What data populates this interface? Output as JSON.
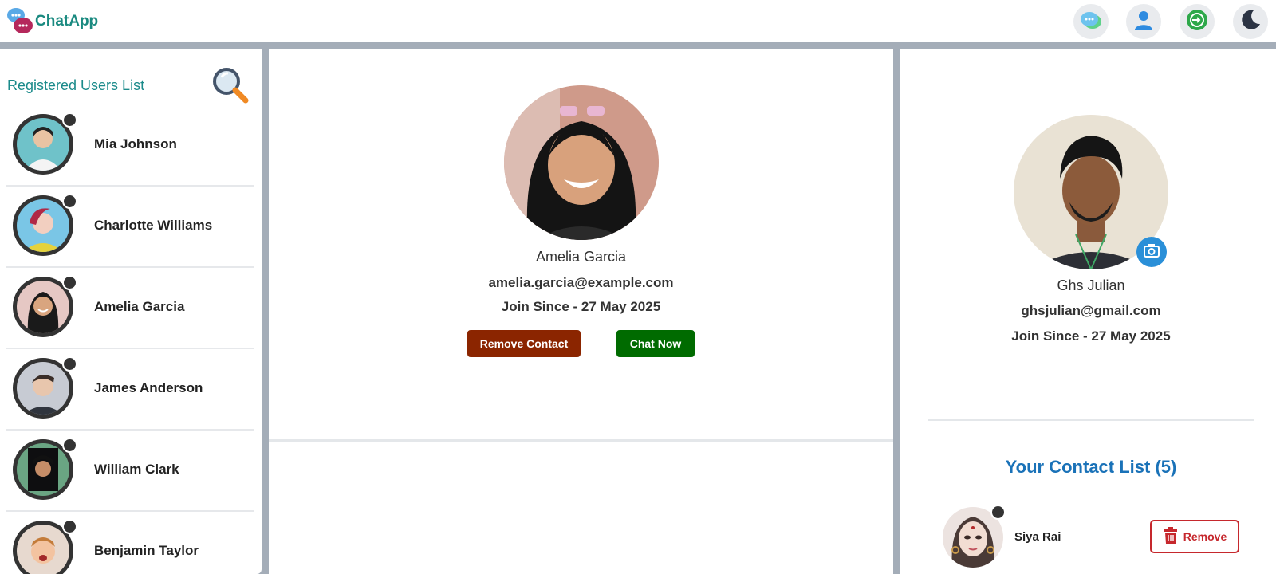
{
  "header": {
    "app_name": "ChatApp",
    "icons": [
      "chat-bubbles-icon",
      "user-icon",
      "logout-icon",
      "moon-icon"
    ],
    "accent_color": "#1a8a80"
  },
  "left_panel": {
    "title": "Registered Users List",
    "search_icon": "magnifier-icon",
    "users": [
      {
        "name": "Mia Johnson"
      },
      {
        "name": "Charlotte Williams"
      },
      {
        "name": "Amelia Garcia"
      },
      {
        "name": "James Anderson"
      },
      {
        "name": "William Clark"
      },
      {
        "name": "Benjamin Taylor"
      }
    ]
  },
  "center_panel": {
    "name": "Amelia Garcia",
    "email": "amelia.garcia@example.com",
    "join_since": "Join Since - 27 May 2025",
    "remove_contact_label": "Remove Contact",
    "chat_now_label": "Chat Now",
    "remove_color": "#8b2500",
    "chat_color": "#006b00"
  },
  "right_panel": {
    "name": "Ghs Julian",
    "email": "ghsjulian@gmail.com",
    "join_since": "Join Since - 27 May 2025",
    "contacts_title": "Your Contact List (5)",
    "contacts": [
      {
        "name": "Siya Rai",
        "remove_label": "Remove"
      }
    ],
    "title_color": "#1a72b8",
    "remove_color": "#c6282d"
  }
}
